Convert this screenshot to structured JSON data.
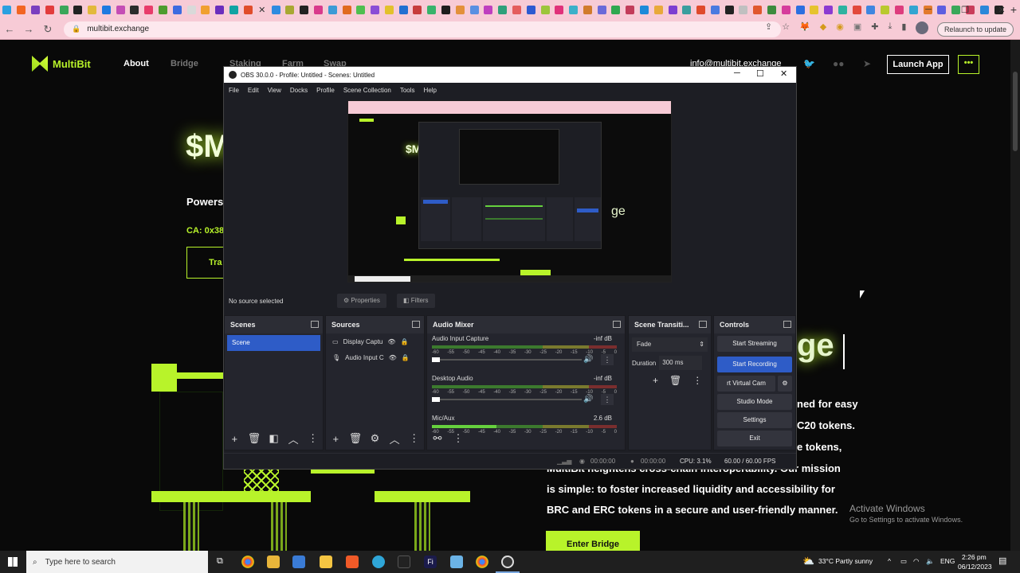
{
  "browser": {
    "url": "multibit.exchange",
    "relaunch_label": "Relaunch to update",
    "tab_colors": [
      "#2aa0e0",
      "#f26522",
      "#7a3fbf",
      "#e23c3c",
      "#3aa65a",
      "#222222",
      "#e2b93c",
      "#1f7ae0",
      "#c44db5",
      "#2b2b2b",
      "#e83c6a",
      "#4d9c2e",
      "#3d6be0",
      "#d9d9d9",
      "#f0a030",
      "#6a2ebd",
      "#11a3a3",
      "#e04d2b",
      "#2e8be0",
      "#a8a832",
      "#222222",
      "#d93a8c",
      "#3c9bd6",
      "#e06a1f",
      "#4fbf4f",
      "#8a4dd6",
      "#e2c12b",
      "#226fd1",
      "#c73c3c",
      "#37b36b",
      "#1d1d1d",
      "#e3903a",
      "#5a8fe2",
      "#bf3fbf",
      "#2ea07a",
      "#e45d5d",
      "#2d5ad1",
      "#9cc53a",
      "#e0317a",
      "#3bb0c9",
      "#d17b2c",
      "#6a6ad9",
      "#2fa84f",
      "#c23c5a",
      "#1c8ad9",
      "#e8a93a",
      "#7d3ed1",
      "#3a9e9e",
      "#df4a2b",
      "#4a7ae0",
      "#222222",
      "#c0c0c0",
      "#e0582e",
      "#3d8b3d",
      "#d63c9c",
      "#2c6fe0",
      "#e6c32e",
      "#8b3ad1",
      "#2fb3a0",
      "#e2493c",
      "#3f86e0",
      "#b9c92e",
      "#dd3c7d",
      "#33a5d1",
      "#e27a2c",
      "#5e5ee0",
      "#3aa85a",
      "#c93c5a",
      "#2a87d9",
      "#222222"
    ],
    "tab_close": "✕",
    "new_tab": "+"
  },
  "site": {
    "brand": "MultiBit",
    "nav": [
      "About",
      "Bridge",
      "Staking",
      "Farm",
      "Swap"
    ],
    "email": "info@multibit.exchange",
    "launch_label": "Launch App",
    "more_label": "•••",
    "token_partial": "$M",
    "powers_partial": "Powers",
    "ca_partial": "CA: 0x38",
    "trade_partial": "Tra",
    "headline_partial": "ge",
    "body_lines": [
      "ned for easy",
      "C20 tokens.",
      "e tokens,",
      "MultiBit heightens cross-chain interoperability. Our mission",
      "is simple: to foster increased liquidity and accessibility for",
      "BRC and ERC tokens in a secure and user-friendly manner."
    ],
    "cta_label": "Enter Bridge",
    "activate_title": "Activate Windows",
    "activate_sub": "Go to Settings to activate Windows."
  },
  "obs": {
    "title": "OBS 30.0.0 - Profile: Untitled - Scenes: Untitled",
    "menu": [
      "File",
      "Edit",
      "View",
      "Docks",
      "Profile",
      "Scene Collection",
      "Tools",
      "Help"
    ],
    "no_source": "No source selected",
    "properties_label": "Properties",
    "filters_label": "Filters",
    "docks": {
      "scenes_title": "Scenes",
      "sources_title": "Sources",
      "mixer_title": "Audio Mixer",
      "transitions_title": "Scene Transiti...",
      "controls_title": "Controls"
    },
    "scenes": [
      "Scene"
    ],
    "sources": [
      "Display Captu",
      "Audio Input C"
    ],
    "mixer": [
      {
        "name": "Audio Input Capture",
        "level": "-inf dB"
      },
      {
        "name": "Desktop Audio",
        "level": "-inf dB"
      },
      {
        "name": "Mic/Aux",
        "level": "2.6 dB"
      }
    ],
    "meter_ticks": [
      "-60",
      "-55",
      "-50",
      "-45",
      "-40",
      "-35",
      "-30",
      "-25",
      "-20",
      "-15",
      "-10",
      "-5",
      "0"
    ],
    "transition": "Fade",
    "duration_label": "Duration",
    "duration_value": "300 ms",
    "controls": [
      "Start Streaming",
      "Start Recording",
      "rt Virtual Cam",
      "Studio Mode",
      "Settings",
      "Exit"
    ],
    "status": {
      "rec_time": "00:00:00",
      "stream_time": "00:00:00",
      "cpu": "CPU: 3.1%",
      "fps": "60.00 / 60.00 FPS"
    }
  },
  "taskbar": {
    "search_placeholder": "Type here to search",
    "weather": "33°C  Partly sunny",
    "lang": "ENG",
    "time": "2:26 pm",
    "date": "06/12/2023"
  }
}
